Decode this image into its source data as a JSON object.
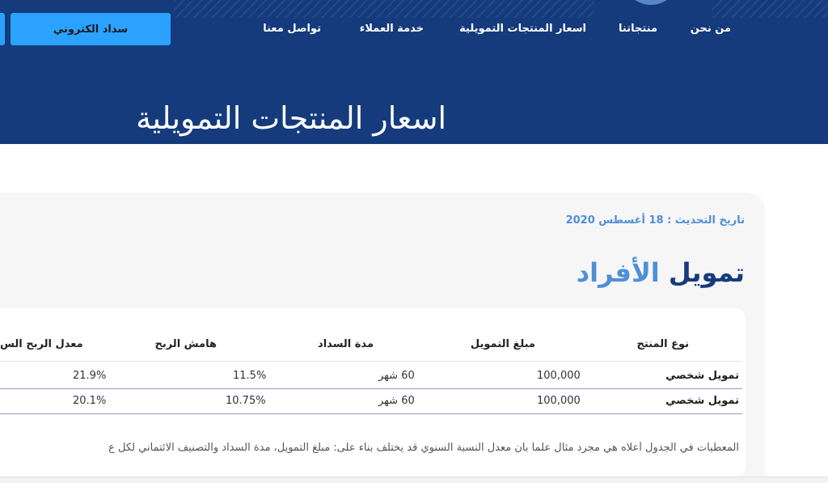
{
  "header": {
    "nav": [
      {
        "label": "من نحن"
      },
      {
        "label": "منتجاتنا"
      },
      {
        "label": "اسعار المنتجات التمويلية"
      },
      {
        "label": "خدمة العملاء"
      },
      {
        "label": "تواصل معنا"
      }
    ],
    "pay_button": "سداد الكتروني",
    "page_title": "اسعار المنتجات التمويلية"
  },
  "section": {
    "updated": "تاريخ التحديث : 18 أغسطس 2020",
    "title_part1": "تمويل",
    "title_part2": "الأفراد"
  },
  "table": {
    "headers": [
      "نوع المنتج",
      "مبلغ التمويل",
      "مدة السداد",
      "هامش الربح",
      "معدل الربح الس"
    ],
    "rows": [
      [
        "تمويل شخصي",
        "100,000",
        "60 شهر",
        "11.5%",
        "21.9%"
      ],
      [
        "تمويل شخصي",
        "100,000",
        "60 شهر",
        "10.75%",
        "20.1%"
      ]
    ]
  },
  "note": "المعطيات في الجدول أعلاه هي مجرد مثال علماً بأن معدل النسبة السنوي قد يختلف بناء على: مبلغ التمويل، مدة السداد والتصنيف الائتماني لكل ع",
  "colors": {
    "header_bg": "#153b7c",
    "accent": "#2ba2ff",
    "link_blue": "#4f8fd6"
  }
}
